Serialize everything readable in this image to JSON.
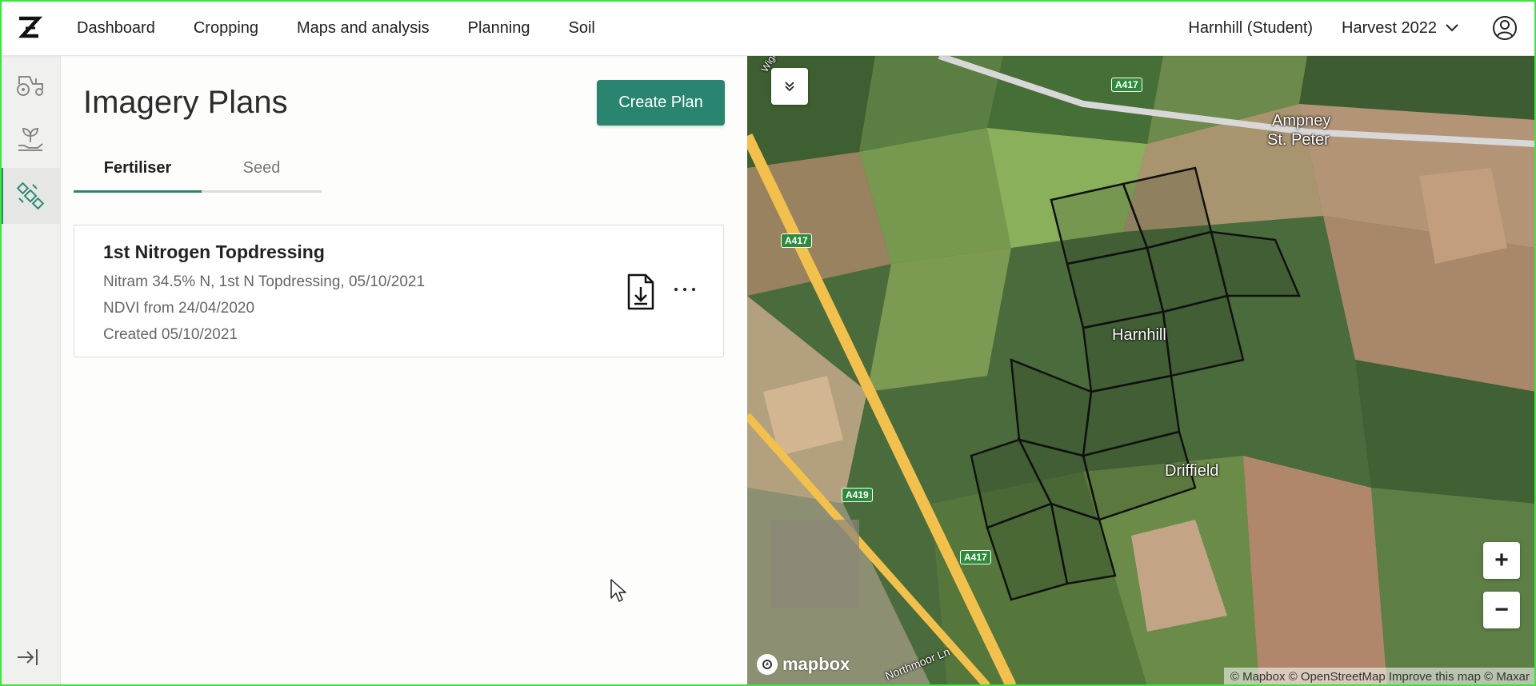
{
  "nav": {
    "items": [
      "Dashboard",
      "Cropping",
      "Maps and analysis",
      "Planning",
      "Soil"
    ],
    "user": "Harnhill (Student)",
    "harvest": "Harvest 2022"
  },
  "rail": {
    "items": [
      "tractor-icon",
      "seedling-hand-icon",
      "satellite-icon"
    ],
    "active_index": 2
  },
  "page": {
    "title": "Imagery Plans",
    "create_button": "Create Plan",
    "tabs": [
      "Fertiliser",
      "Seed"
    ],
    "active_tab": "Fertiliser"
  },
  "plans": [
    {
      "title": "1st Nitrogen Topdressing",
      "line1": "Nitram 34.5% N, 1st N Topdressing, 05/10/2021",
      "line2": "NDVI from 24/04/2020",
      "line3": "Created 05/10/2021"
    }
  ],
  "map": {
    "places": [
      "Ampney",
      "St. Peter",
      "Harnhill",
      "Driffield",
      "Northmoor Ln",
      "Wigh"
    ],
    "roads": [
      "A417",
      "A417",
      "A419",
      "A417"
    ],
    "mapbox_logo": "mapbox",
    "attribution": "© Mapbox © OpenStreetMap Improve this map © Maxar",
    "zoom_in": "+",
    "zoom_out": "−"
  },
  "colors": {
    "accent": "#2a8570",
    "active_rail": "#2a8a74",
    "road": "#f2c04c"
  }
}
